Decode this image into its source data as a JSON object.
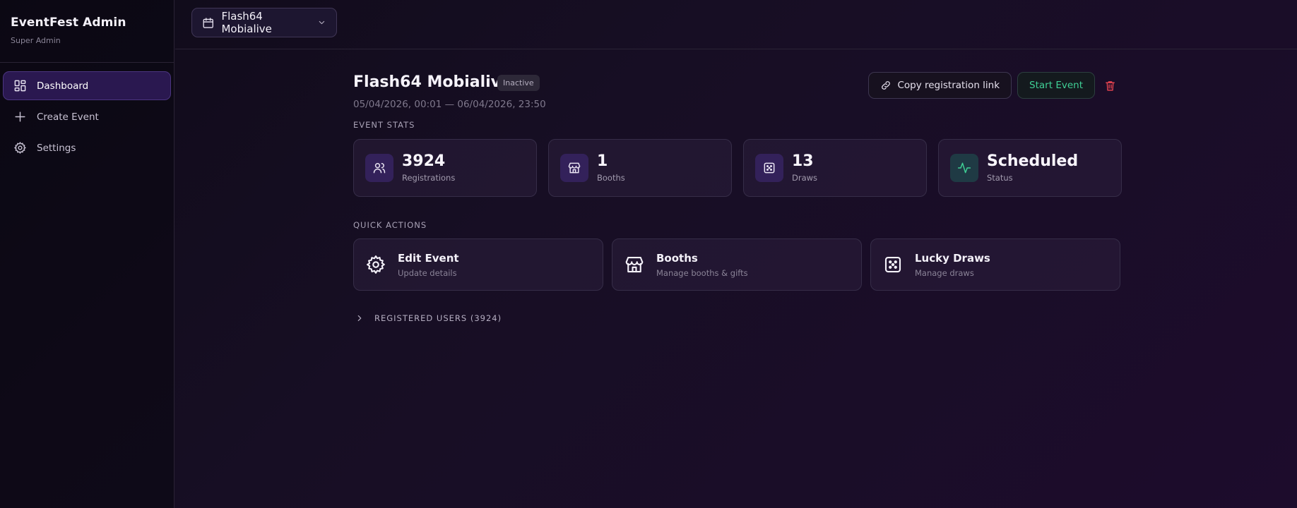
{
  "sidebar": {
    "brand_title": "EventFest Admin",
    "brand_sub": "Super Admin",
    "items": [
      {
        "label": "Dashboard",
        "icon": "dashboard-grid-icon",
        "active": true
      },
      {
        "label": "Create Event",
        "icon": "plus-icon",
        "active": false
      },
      {
        "label": "Settings",
        "icon": "gear-icon",
        "active": false
      }
    ]
  },
  "topbar": {
    "selected_event": "Flash64 Mobialive",
    "icons": [
      "calendar-icon",
      "chevron-down-icon"
    ]
  },
  "event": {
    "title": "Flash64 Mobialive",
    "status_badge": "Inactive",
    "dates": "05/04/2026, 00:01 — 06/04/2026, 23:50",
    "actions": {
      "copy_link": "Copy registration link",
      "start": "Start Event"
    }
  },
  "stats": {
    "label": "EVENT STATS",
    "items": [
      {
        "value": "3924",
        "label": "Registrations",
        "icon": "users-icon"
      },
      {
        "value": "1",
        "label": "Booths",
        "icon": "store-icon"
      },
      {
        "value": "13",
        "label": "Draws",
        "icon": "dice-icon"
      },
      {
        "value": "Scheduled",
        "label": "Status",
        "icon": "activity-icon"
      }
    ]
  },
  "quick_actions": {
    "label": "QUICK ACTIONS",
    "items": [
      {
        "title": "Edit Event",
        "sub": "Update details",
        "icon": "gear-icon"
      },
      {
        "title": "Booths",
        "sub": "Manage booths & gifts",
        "icon": "store-icon"
      },
      {
        "title": "Lucky Draws",
        "sub": "Manage draws",
        "icon": "dice-icon"
      }
    ]
  },
  "registered_users": {
    "label": "REGISTERED USERS (3924)"
  },
  "colors": {
    "accent": "#2a1850",
    "start_green": "#3fcf95",
    "danger": "#e0424f"
  }
}
